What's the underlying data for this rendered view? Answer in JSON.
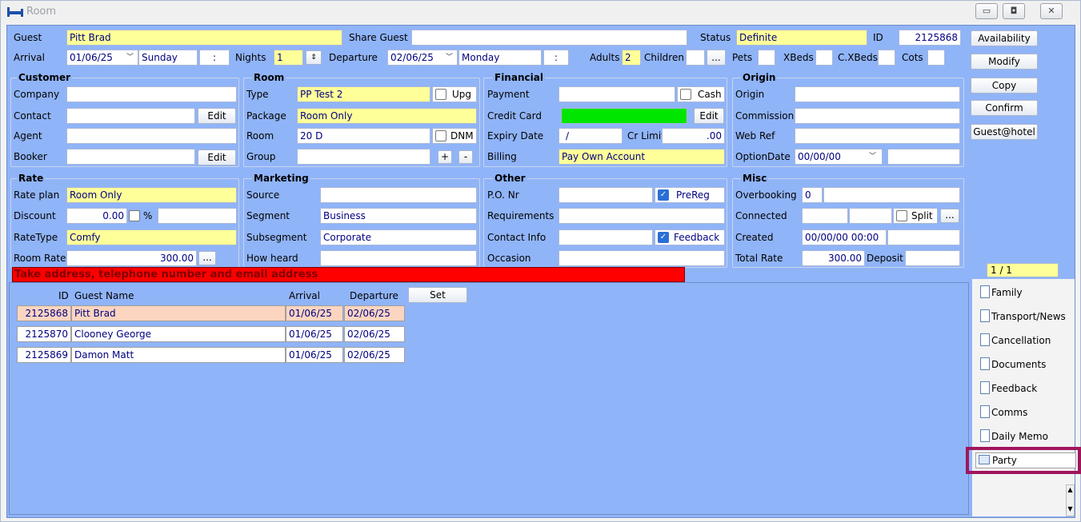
{
  "window": {
    "title": "Room"
  },
  "top": {
    "guest_label": "Guest",
    "guest_value": "Pitt Brad",
    "share_label": "Share Guest",
    "share_value": "",
    "status_label": "Status",
    "status_value": "Definite",
    "id_label": "ID",
    "id_value": "2125868",
    "arrival_label": "Arrival",
    "arrival_date": "01/06/25",
    "arrival_day": "Sunday",
    "arrival_time": ":",
    "nights_label": "Nights",
    "nights_value": "1",
    "departure_label": "Departure",
    "departure_date": "02/06/25",
    "departure_day": "Monday",
    "departure_time": ":",
    "adults_label": "Adults",
    "adults_value": "2",
    "children_label": "Children",
    "children_value": "",
    "children_btn": "...",
    "pets_label": "Pets",
    "xbeds_label": "XBeds",
    "cxbeds_label": "C.XBeds",
    "cots_label": "Cots"
  },
  "customer": {
    "title": "Customer",
    "company_label": "Company",
    "contact_label": "Contact",
    "agent_label": "Agent",
    "booker_label": "Booker",
    "edit1": "Edit",
    "edit2": "Edit"
  },
  "room": {
    "title": "Room",
    "type_label": "Type",
    "type_value": "PP Test 2",
    "upg_label": "Upg",
    "package_label": "Package",
    "package_value": "Room Only",
    "room_label": "Room",
    "room_value": "20 D",
    "dnm_label": "DNM",
    "group_label": "Group",
    "plus": "+",
    "minus": "-"
  },
  "financial": {
    "title": "Financial",
    "payment_label": "Payment",
    "cash_label": "Cash",
    "cc_label": "Credit Card",
    "edit": "Edit",
    "expiry_label": "Expiry Date",
    "expiry_value": "/",
    "crlimit_label": "Cr Limit",
    "crlimit_value": ".00",
    "billing_label": "Billing",
    "billing_value": "Pay Own Account"
  },
  "origin": {
    "title": "Origin",
    "origin_label": "Origin",
    "commission_label": "Commission",
    "webref_label": "Web Ref",
    "optiondate_label": "OptionDate",
    "optiondate_value": "00/00/00"
  },
  "rate": {
    "title": "Rate",
    "plan_label": "Rate plan",
    "plan_value": "Room Only",
    "discount_label": "Discount",
    "discount_value": "0.00",
    "pct_label": "%",
    "ratetype_label": "RateType",
    "ratetype_value": "Comfy",
    "roomrate_label": "Room Rate",
    "roomrate_value": "300.00",
    "more": "..."
  },
  "marketing": {
    "title": "Marketing",
    "source_label": "Source",
    "segment_label": "Segment",
    "segment_value": "Business",
    "subsegment_label": "Subsegment",
    "subsegment_value": "Corporate",
    "howheard_label": "How heard"
  },
  "other": {
    "title": "Other",
    "po_label": "P.O. Nr",
    "prereg_label": "PreReg",
    "req_label": "Requirements",
    "contact_label": "Contact Info",
    "feedback_label": "Feedback",
    "occasion_label": "Occasion"
  },
  "misc": {
    "title": "Misc",
    "overbooking_label": "Overbooking",
    "overbooking_value": "0",
    "connected_label": "Connected",
    "split_label": "Split",
    "more": "...",
    "created_label": "Created",
    "created_value": "00/00/00 00:00",
    "totalrate_label": "Total Rate",
    "totalrate_value": "300.00",
    "deposit_label": "Deposit"
  },
  "side_buttons": [
    "Availability",
    "Modify",
    "Copy",
    "Confirm",
    "Guest@hotel"
  ],
  "page_indicator": "1 / 1",
  "alert": "Take address, telephone number and email address",
  "grid": {
    "headers": {
      "id": "ID",
      "name": "Guest Name",
      "arrival": "Arrival",
      "departure": "Departure",
      "set": "Set"
    },
    "rows": [
      {
        "id": "2125868",
        "name": "Pitt Brad",
        "arrival": "01/06/25",
        "departure": "02/06/25"
      },
      {
        "id": "2125870",
        "name": "Clooney George",
        "arrival": "01/06/25",
        "departure": "02/06/25"
      },
      {
        "id": "2125869",
        "name": "Damon Matt",
        "arrival": "01/06/25",
        "departure": "02/06/25"
      }
    ]
  },
  "tabs": [
    "Family",
    "Transport/News",
    "Cancellation",
    "Documents",
    "Feedback",
    "Comms",
    "Daily Memo",
    "Party"
  ],
  "colors": {
    "panel": "#90b4f8",
    "required": "#ffff99",
    "alert": "#ff0000",
    "selected_row": "#fcd5c0",
    "highlight_border": "#a0155c"
  }
}
